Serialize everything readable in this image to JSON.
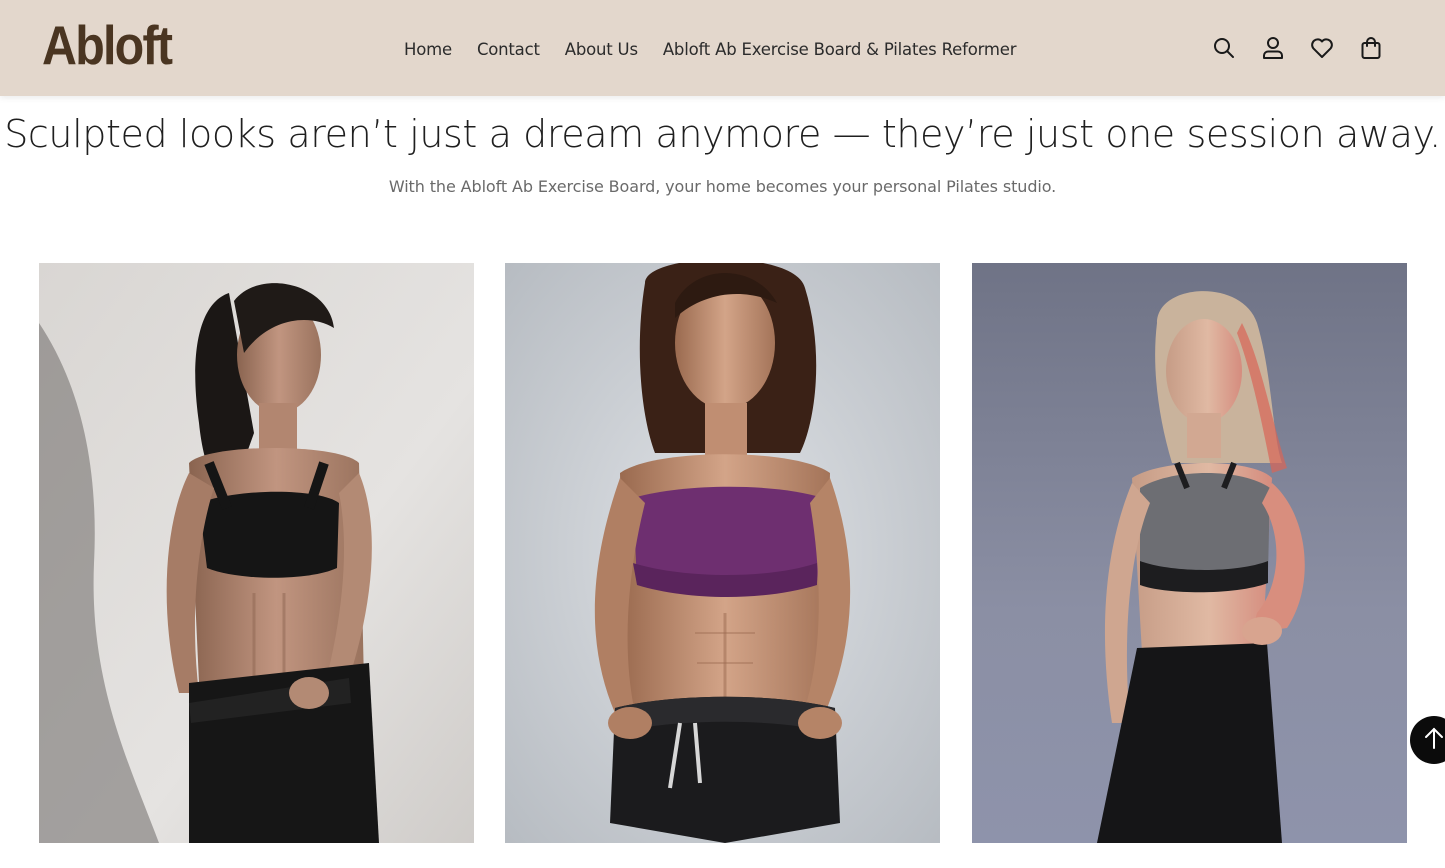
{
  "brand": {
    "logo_text": "Abloft",
    "logo_color": "#4a3521",
    "header_bg": "#e3d7cc"
  },
  "nav": {
    "items": [
      {
        "label": "Home"
      },
      {
        "label": "Contact"
      },
      {
        "label": "About Us"
      },
      {
        "label": "Abloft Ab Exercise Board & Pilates Reformer"
      }
    ]
  },
  "header_icons": [
    "search-icon",
    "account-icon",
    "wishlist-heart-icon",
    "shopping-bag-icon"
  ],
  "hero": {
    "title": "Sculpted looks aren’t just a dream anymore — they’re just one session away.",
    "subtitle": "With the Abloft Ab Exercise Board, your home becomes your personal Pilates studio."
  },
  "gallery": {
    "images": [
      {
        "subject": "woman-black-sports-bra-leaning-on-wall",
        "bg": "#dcdad8"
      },
      {
        "subject": "woman-purple-bandeau-black-shorts",
        "bg": "#c9cdd2"
      },
      {
        "subject": "woman-grey-sports-top-hand-on-hip",
        "bg": "#8b8fa3"
      }
    ]
  },
  "back_to_top": {
    "icon": "arrow-up-icon"
  }
}
